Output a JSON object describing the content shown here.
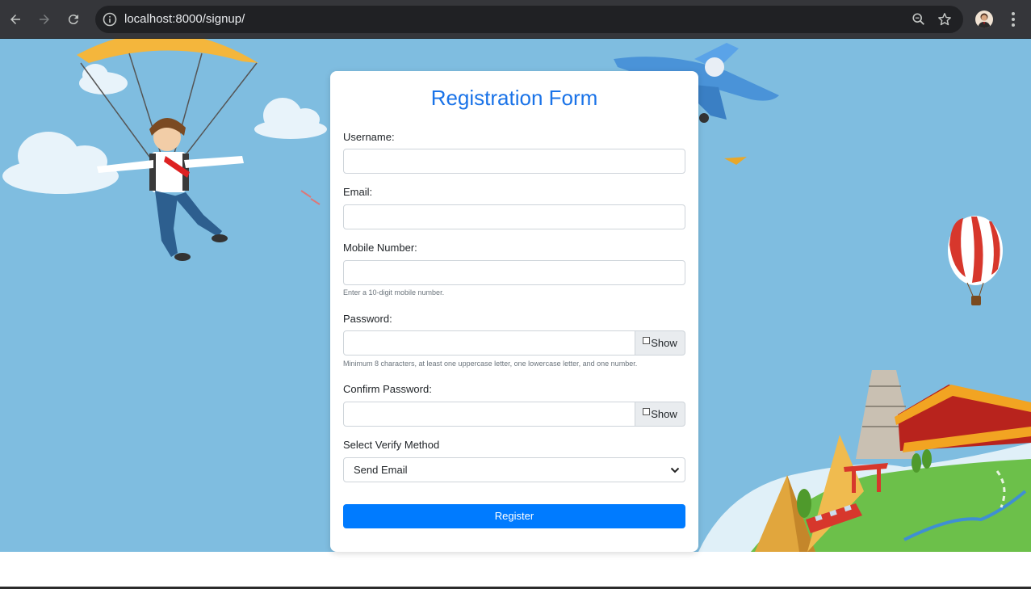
{
  "browser": {
    "url": "localhost:8000/signup/",
    "icons": [
      "back-arrow-icon",
      "forward-arrow-icon",
      "reload-icon",
      "site-info-icon",
      "zoom-icon",
      "bookmark-star-icon",
      "profile-avatar",
      "kebab-menu-icon"
    ]
  },
  "form": {
    "title": "Registration Form",
    "username_label": "Username:",
    "email_label": "Email:",
    "mobile_label": "Mobile Number:",
    "mobile_hint": "Enter a 10-digit mobile number.",
    "password_label": "Password:",
    "password_show": "Show",
    "password_hint": "Minimum 8 characters, at least one uppercase letter, one lowercase letter, and one number.",
    "confirm_label": "Confirm Password:",
    "confirm_show": "Show",
    "verify_label": "Select Verify Method",
    "verify_selected": "Send Email",
    "register_label": "Register"
  },
  "colors": {
    "accent": "#007bff",
    "title": "#1a73e8",
    "sky": "#7fbde0"
  }
}
